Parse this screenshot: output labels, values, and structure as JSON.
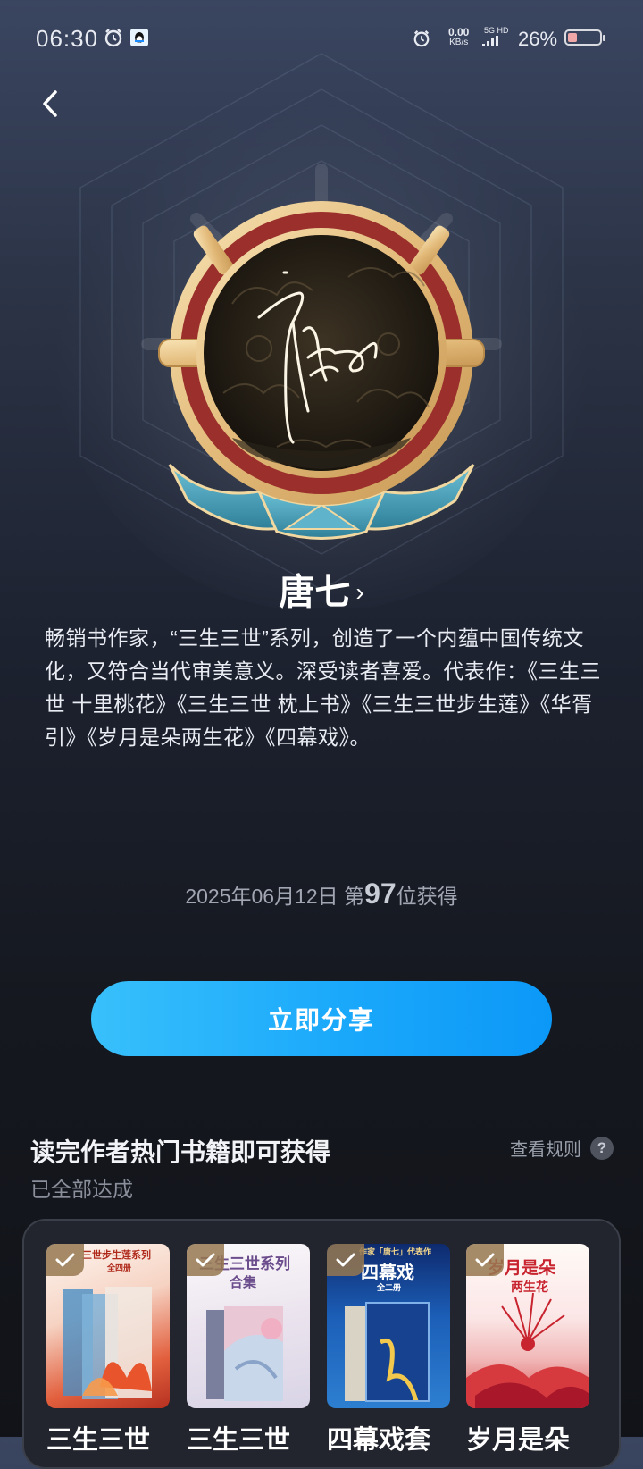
{
  "status_bar": {
    "time": "06:30",
    "net_speed_value": "0.00",
    "net_speed_unit": "KB/s",
    "network": "5G HD",
    "battery": "26%",
    "icons": [
      "alarm-icon",
      "qq-app-icon",
      "alarm-icon",
      "signal-icon",
      "battery-icon"
    ]
  },
  "author": {
    "name": "唐七",
    "bio": "畅销书作家，“三生三世”系列，创造了一个内蕴中国传统文化，又符合当代审美意义。深受读者喜爱。代表作：《三生三世 十里桃花》《三生三世 枕上书》《三生三世步生莲》《华胥引》《岁月是朵两生花》《四幕戏》。"
  },
  "obtain": {
    "date": "2025年06月12日",
    "prefix": "第",
    "rank": "97",
    "suffix": "位获得"
  },
  "share_button": "立即分享",
  "task": {
    "title": "读完作者热门书籍即可获得",
    "status": "已全部达成",
    "rules": "查看规则",
    "rules_icon": "?"
  },
  "books": [
    {
      "title": "三生三世",
      "cover_text": "三世步生莲系列",
      "cover_subtext": "全四册"
    },
    {
      "title": "三生三世",
      "cover_text": "三生三世系列",
      "cover_subtext": "合集"
    },
    {
      "title": "四幕戏套",
      "cover_text": "四幕戏",
      "cover_subtext": "全二册",
      "cover_top": "作家「唐七」代表作"
    },
    {
      "title": "岁月是朵",
      "cover_text": "岁月是朵",
      "cover_subtext": "两生花"
    }
  ],
  "colors": {
    "accent": "#1aa8fb",
    "medal_gold": "#e9c98e",
    "medal_teal": "#3f8fa8",
    "medal_red": "#9a2f2c"
  }
}
